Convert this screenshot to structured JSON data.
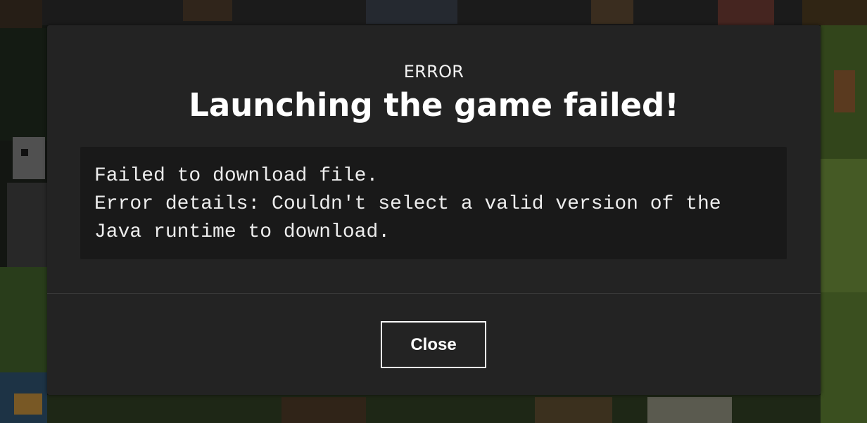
{
  "dialog": {
    "kicker": "ERROR",
    "title": "Launching the game failed!",
    "details": [
      "Failed to download file.",
      "Error details: Couldn't select a valid version of the",
      "Java runtime to download."
    ],
    "close_label": "Close"
  },
  "colors": {
    "dialog_background": "#232323",
    "details_background": "#191919",
    "text": "#ffffff",
    "button_border": "#ffffff"
  }
}
